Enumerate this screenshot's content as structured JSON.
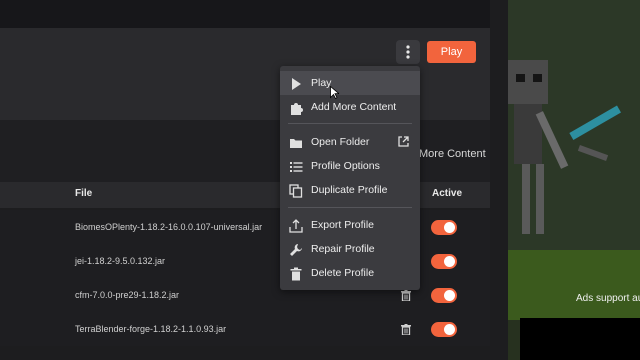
{
  "header": {
    "play_label": "Play"
  },
  "more_content_label": "More Content",
  "table": {
    "columns": [
      "File",
      "Active"
    ],
    "rows": [
      {
        "file": "BiomesOPlenty-1.18.2-16.0.0.107-universal.jar",
        "active": true
      },
      {
        "file": "jei-1.18.2-9.5.0.132.jar",
        "active": true
      },
      {
        "file": "cfm-7.0.0-pre29-1.18.2.jar",
        "active": true
      },
      {
        "file": "TerraBlender-forge-1.18.2-1.1.0.93.jar",
        "active": true
      }
    ]
  },
  "context_menu": {
    "items": [
      {
        "label": "Play",
        "icon": "play-icon"
      },
      {
        "label": "Add More Content",
        "icon": "puzzle-icon"
      },
      {
        "label": "Open Folder",
        "icon": "folder-icon"
      },
      {
        "label": "Profile Options",
        "icon": "list-icon"
      },
      {
        "label": "Duplicate Profile",
        "icon": "duplicate-icon"
      },
      {
        "label": "Export Profile",
        "icon": "export-icon"
      },
      {
        "label": "Repair Profile",
        "icon": "wrench-icon"
      },
      {
        "label": "Delete Profile",
        "icon": "trash-icon"
      }
    ]
  },
  "ad_panel": {
    "text": "Ads support au"
  },
  "colors": {
    "accent": "#f2643d",
    "menu_bg": "#3b3b3f"
  }
}
